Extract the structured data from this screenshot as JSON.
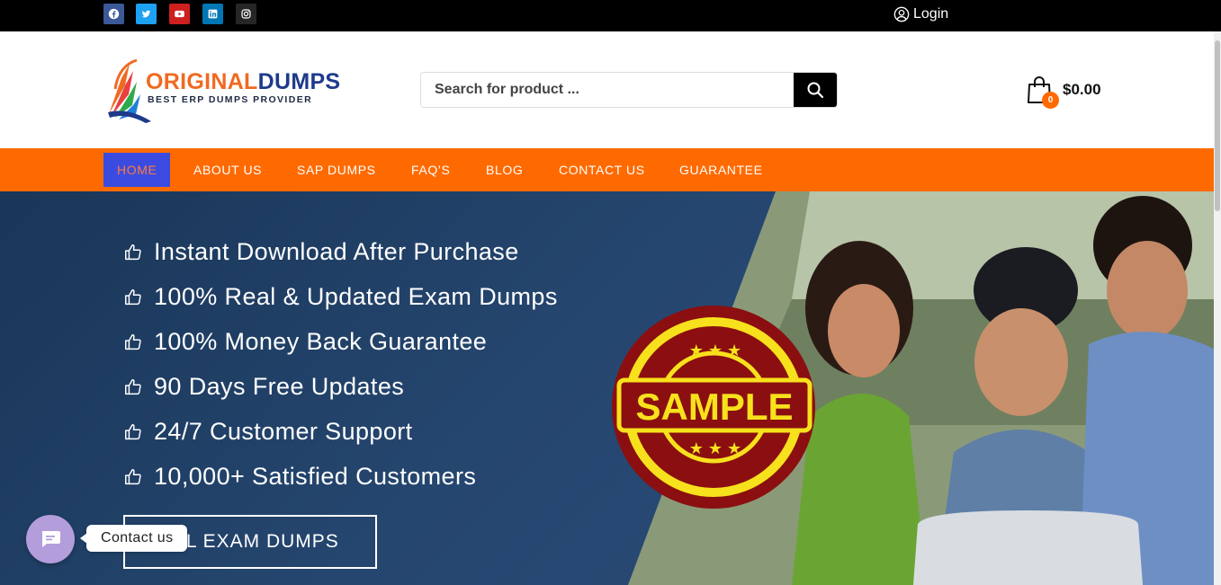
{
  "topbar": {
    "social": [
      {
        "name": "facebook-icon"
      },
      {
        "name": "twitter-icon"
      },
      {
        "name": "youtube-icon"
      },
      {
        "name": "linkedin-icon"
      },
      {
        "name": "instagram-icon"
      }
    ],
    "login_label": "Login"
  },
  "header": {
    "logo": {
      "brand_part1": "ORIGINAL",
      "brand_part2": "DUMPS",
      "tagline": "BEST ERP DUMPS PROVIDER"
    },
    "search": {
      "placeholder": "Search for product ..."
    },
    "cart": {
      "count": "0",
      "total": "$0.00"
    }
  },
  "nav": {
    "items": [
      {
        "label": "HOME"
      },
      {
        "label": "ABOUT US"
      },
      {
        "label": "SAP DUMPS"
      },
      {
        "label": "FAQ’S"
      },
      {
        "label": "BLOG"
      },
      {
        "label": "CONTACT US"
      },
      {
        "label": "GUARANTEE"
      }
    ]
  },
  "hero": {
    "features": [
      "Instant Download After Purchase",
      "100% Real & Updated Exam Dumps",
      "100% Money Back Guarantee",
      "90 Days Free Updates",
      "24/7 Customer Support",
      "10,000+ Satisfied Customers"
    ],
    "button_label": "ALL EXAM DUMPS",
    "stamp_text": "SAMPLE"
  },
  "contact_widget": {
    "label": "Contact us"
  },
  "colors": {
    "accent": "#ff6a00",
    "nav_active": "#3b4be0",
    "hero_bg": "#25466f"
  }
}
